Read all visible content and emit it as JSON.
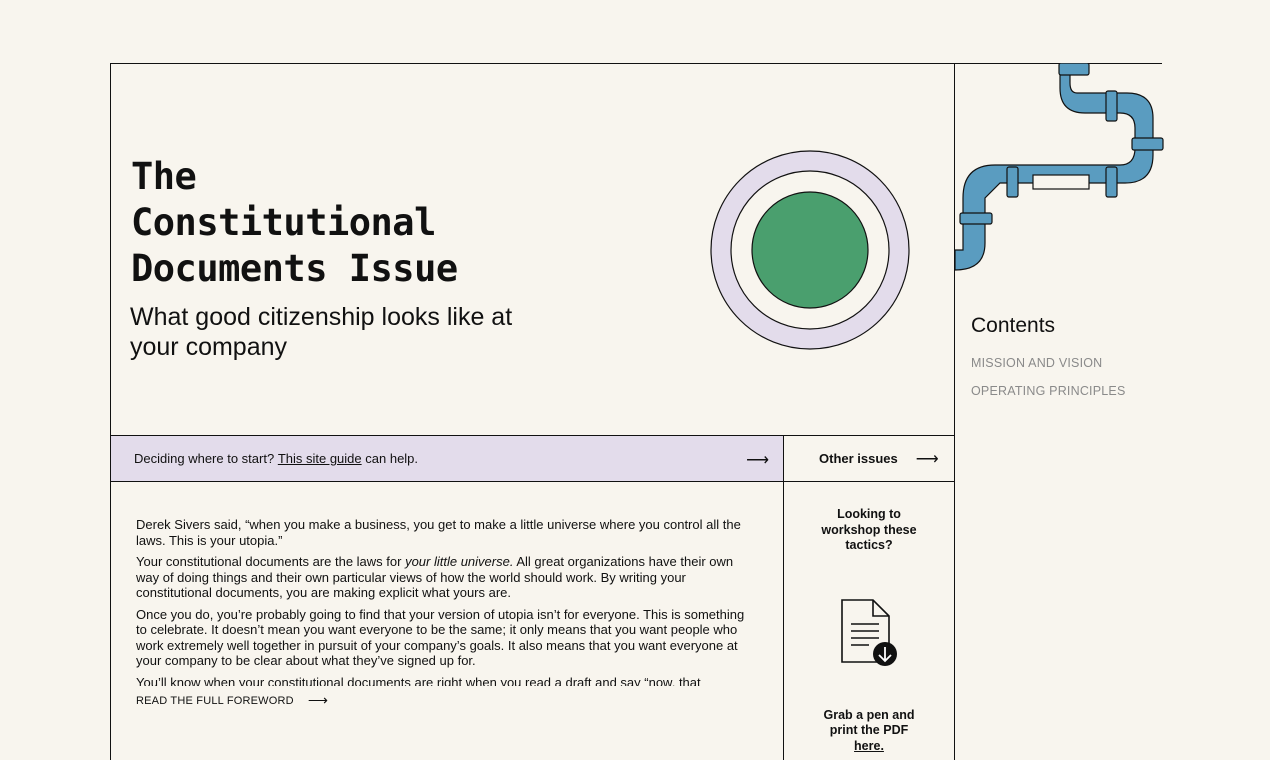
{
  "hero": {
    "title": "The\nConstitutional\nDocuments Issue",
    "subtitle": "What good citizenship looks like at your company"
  },
  "guide_bar": {
    "prefix": "Deciding where to start?",
    "link": "This site guide",
    "suffix": "can help.",
    "arrow": "⟶"
  },
  "other_issues": {
    "label": "Other issues",
    "arrow": "⟶"
  },
  "foreword": {
    "p1": "Derek Sivers said, “when you make a business, you get to make a little universe where you control all the laws. This is your utopia.”",
    "p2_a": "Your constitutional documents are the laws for ",
    "p2_em": "your little universe.",
    "p2_b": " All great organizations have their own way of doing things and their own particular views of how the world should work. By writing your constitutional documents, you are making explicit what yours are.",
    "p3": "Once you do, you’re probably going to find that your version of utopia isn’t for everyone. This is something to celebrate. It doesn’t mean you want everyone to be the same; it only means that you want people who work extremely well together in pursuit of your company’s goals. It also means that you want everyone at your company to be clear about what they’ve signed up for.",
    "p4": "You’ll know when your constitutional documents are right when you read a draft and say “now, that",
    "read_more": "READ THE FULL FOREWORD",
    "read_more_arrow": "⟶"
  },
  "side_cta": {
    "top": "Looking to workshop these tactics?",
    "bottom": "Grab a pen and print the PDF",
    "link": "here."
  },
  "contents": {
    "title": "Contents",
    "items": [
      "MISSION AND VISION",
      "OPERATING PRINCIPLES"
    ]
  },
  "colors": {
    "background": "#f8f5ee",
    "lavender": "#e3dceb",
    "green": "#4a9f6e",
    "pipe_blue": "#5a9cc0"
  },
  "icons": [
    "target-circle-illustration",
    "pipe-illustration",
    "document-download-icon",
    "arrow-right-icon"
  ]
}
